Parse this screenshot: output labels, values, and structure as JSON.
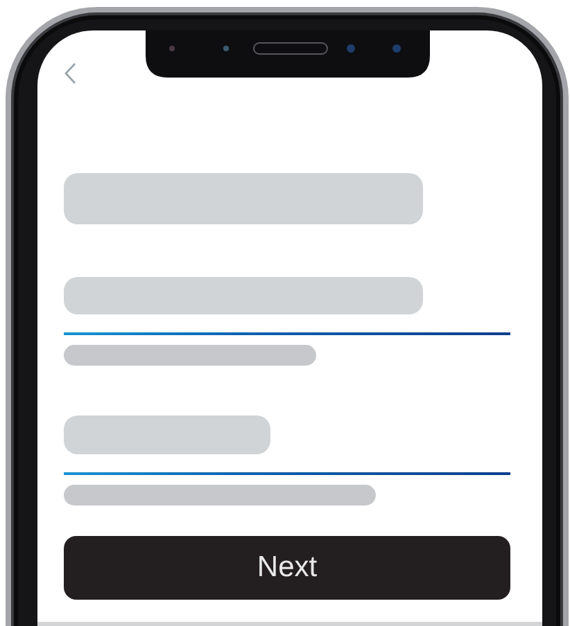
{
  "screen": {
    "primary_button": {
      "label": "Next"
    }
  }
}
